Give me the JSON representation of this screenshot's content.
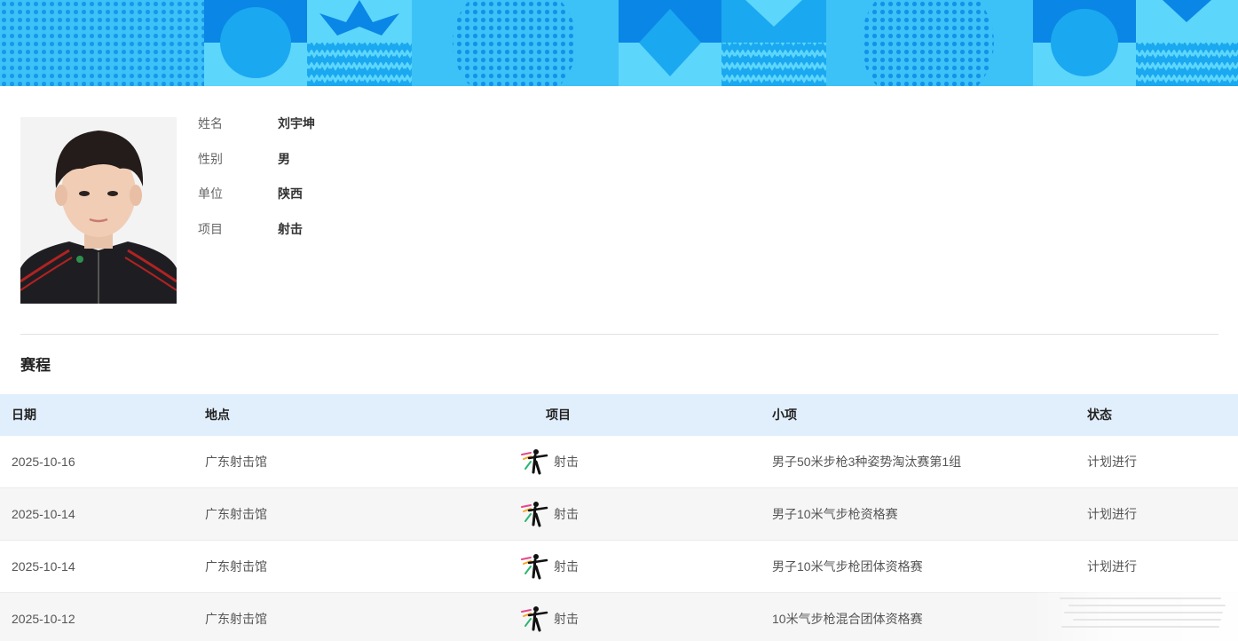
{
  "banner": {
    "colors": {
      "light": "#5dd6fb",
      "mid": "#1aa8f0",
      "dark": "#0a86e6"
    }
  },
  "profile": {
    "photo": {
      "icon": "athlete-portrait"
    },
    "fields": [
      {
        "label": "姓名",
        "value": "刘宇坤"
      },
      {
        "label": "性别",
        "value": "男"
      },
      {
        "label": "单位",
        "value": "陕西"
      },
      {
        "label": "项目",
        "value": "射击"
      }
    ]
  },
  "schedule": {
    "title": "赛程",
    "headers": {
      "date": "日期",
      "venue": "地点",
      "sport": "项目",
      "event": "小项",
      "status": "状态"
    },
    "rows": [
      {
        "date": "2025-10-16",
        "venue": "广东射击馆",
        "sport": "射击",
        "sport_icon": "shooting-icon",
        "event": "男子50米步枪3种姿势淘汰赛第1组",
        "status": "计划进行"
      },
      {
        "date": "2025-10-14",
        "venue": "广东射击馆",
        "sport": "射击",
        "sport_icon": "shooting-icon",
        "event": "男子10米气步枪资格赛",
        "status": "计划进行"
      },
      {
        "date": "2025-10-14",
        "venue": "广东射击馆",
        "sport": "射击",
        "sport_icon": "shooting-icon",
        "event": "男子10米气步枪团体资格赛",
        "status": "计划进行"
      },
      {
        "date": "2025-10-12",
        "venue": "广东射击馆",
        "sport": "射击",
        "sport_icon": "shooting-icon",
        "event": "10米气步枪混合团体资格赛",
        "status": ""
      }
    ]
  },
  "colors": {
    "header_bg": "#e1eefb",
    "alt_row_bg": "#f6f6f6"
  }
}
